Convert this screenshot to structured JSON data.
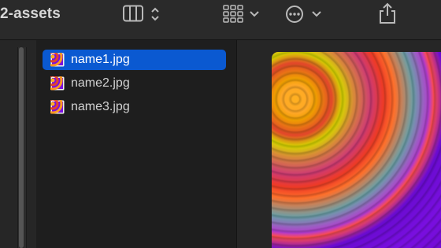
{
  "toolbar": {
    "title": "2-assets",
    "buttons": [
      {
        "name": "column-view",
        "icon": "columns-icon"
      },
      {
        "name": "group-view",
        "icon": "grid-icon"
      },
      {
        "name": "more-actions",
        "icon": "ellipsis-icon"
      },
      {
        "name": "share",
        "icon": "share-icon"
      }
    ]
  },
  "files": [
    {
      "name": "name1.jpg",
      "selected": true
    },
    {
      "name": "name2.jpg",
      "selected": false
    },
    {
      "name": "name3.jpg",
      "selected": false
    }
  ],
  "colors": {
    "selection": "#0a59d1",
    "window_bg": "#1e1e1e",
    "toolbar_bg": "#2a2a2a"
  }
}
